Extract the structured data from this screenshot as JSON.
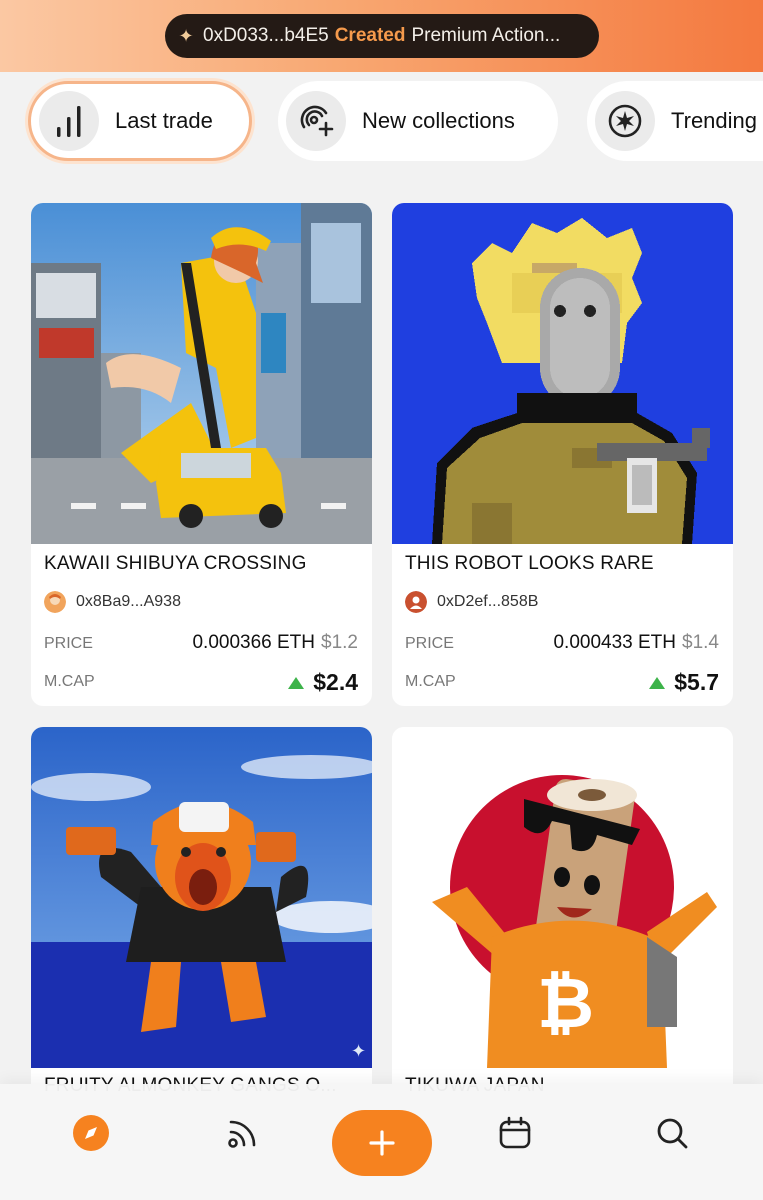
{
  "ticker": {
    "address": "0xD033...b4E5",
    "verb": "Created",
    "object": "Premium Action..."
  },
  "tabs": [
    {
      "label": "Last trade",
      "icon": "bar-chart-icon",
      "active": true
    },
    {
      "label": "New collections",
      "icon": "new-collection-icon",
      "active": false
    },
    {
      "label": "Trending",
      "icon": "trending-burst-icon",
      "active": false
    }
  ],
  "cards": [
    {
      "title": "KAWAII SHIBUYA CROSSING",
      "creator": "0x8Ba9...A938",
      "price_label": "PRICE",
      "price_eth": "0.000366 ETH",
      "price_usd": "$1.2",
      "mcap_label": "M.CAP",
      "mcap": "$2.4"
    },
    {
      "title": "THIS ROBOT LOOKS RARE",
      "creator": "0xD2ef...858B",
      "price_label": "PRICE",
      "price_eth": "0.000433 ETH",
      "price_usd": "$1.4",
      "mcap_label": "M.CAP",
      "mcap": "$5.7"
    },
    {
      "title": "FRUITY ALMONKEY GANGS O..."
    },
    {
      "title": "TIKUWA JAPAN"
    }
  ],
  "nav": [
    {
      "name": "explore",
      "icon": "compass-icon",
      "active": true
    },
    {
      "name": "feed",
      "icon": "feed-icon",
      "active": false
    },
    {
      "name": "create",
      "icon": "plus-icon",
      "active": false
    },
    {
      "name": "calendar",
      "icon": "calendar-icon",
      "active": false
    },
    {
      "name": "search",
      "icon": "search-icon",
      "active": false
    }
  ],
  "colors": {
    "accent": "#f6821f",
    "positive": "#3db34a",
    "banner_dark": "#241a15"
  }
}
